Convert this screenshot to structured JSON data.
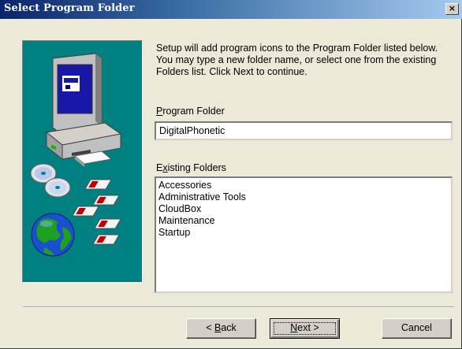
{
  "window": {
    "title": "Select Program Folder",
    "close_glyph": "×"
  },
  "instructions": [
    "Setup will add program icons to the Program Folder listed below.",
    "You may type a new folder name, or select one from the existing",
    "Folders list. Click Next to continue."
  ],
  "program_folder": {
    "label_accel": "P",
    "label_rest": "rogram Folder",
    "value": "DigitalPhonetic"
  },
  "existing_folders": {
    "label_first": "E",
    "label_accel": "x",
    "label_rest": "isting Folders",
    "items": [
      "Accessories",
      "Administrative Tools",
      "CloudBox",
      "Maintenance",
      "Startup"
    ]
  },
  "buttons": {
    "back": {
      "prefix": "< ",
      "accel": "B",
      "rest": "ack"
    },
    "next": {
      "accel": "N",
      "rest": "ext >"
    },
    "cancel": "Cancel"
  },
  "colors": {
    "title_start": "#0a246a",
    "title_end": "#a6caf0",
    "art_background": "#008080",
    "dialog_face": "#ece9d8"
  },
  "icons": [
    "computer-icon",
    "cd-disc-icon",
    "floppy-disk-icon",
    "globe-icon"
  ]
}
